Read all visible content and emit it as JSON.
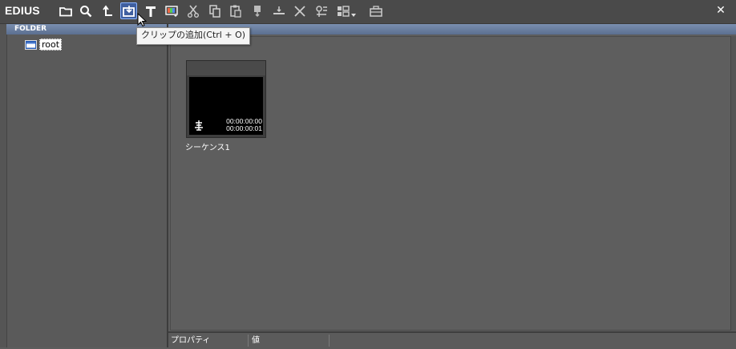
{
  "app": {
    "title": "EDIUS"
  },
  "toolbar": {
    "icons": [
      "folder-icon",
      "search-icon",
      "up-icon",
      "add-clip-icon",
      "title-icon",
      "color-bars-icon",
      "cut-icon",
      "copy-icon",
      "paste-icon",
      "insert-icon",
      "overwrite-icon",
      "delete-icon",
      "properties-icon",
      "view-icon",
      "toolbox-icon"
    ],
    "active": "add-clip-icon",
    "tooltip": "クリップの追加(Ctrl + O)",
    "close_label": "✕"
  },
  "folder_panel": {
    "header": "FOLDER",
    "root_label": "root"
  },
  "clips": [
    {
      "name": "シーケンス1",
      "tc_in": "00:00:00:00",
      "tc_out": "00:00:00:01"
    }
  ],
  "property_bar": {
    "col_property": "プロパティ",
    "col_value": "値"
  },
  "colors": {
    "toolbar_bg": "#4a4a4a",
    "panel_header": "#6d82a6",
    "active_button": "#3f5f9f"
  }
}
